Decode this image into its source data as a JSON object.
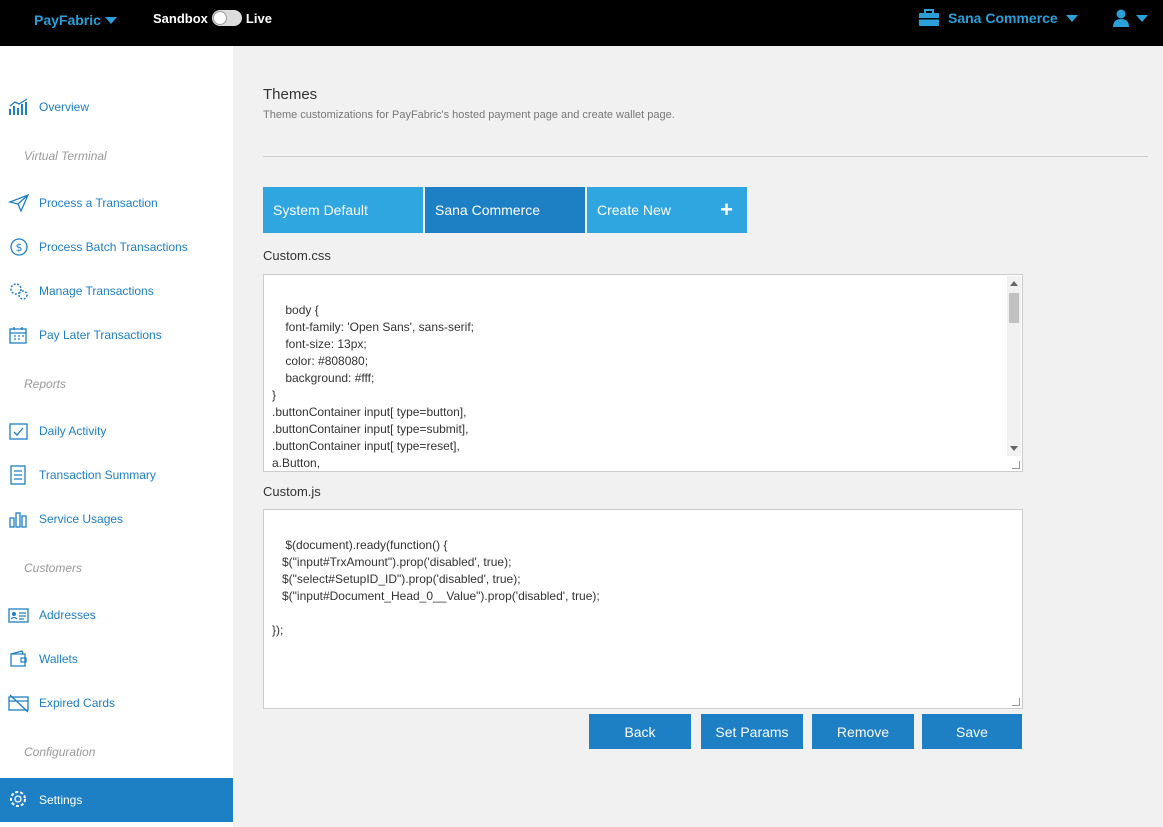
{
  "header": {
    "brand": "PayFabric",
    "env_left": "Sandbox",
    "env_right": "Live",
    "account": "Sana Commerce",
    "accent": "#2a9fd8"
  },
  "sidebar": {
    "items": [
      {
        "label": "Overview",
        "icon": "chart-icon"
      },
      {
        "label": "Process a Transaction",
        "icon": "send-icon"
      },
      {
        "label": "Process Batch Transactions",
        "icon": "dollar-cycle-icon"
      },
      {
        "label": "Manage Transactions",
        "icon": "gears-icon"
      },
      {
        "label": "Pay Later Transactions",
        "icon": "calendar-icon"
      },
      {
        "label": "Daily Activity",
        "icon": "calendar-check-icon"
      },
      {
        "label": "Transaction Summary",
        "icon": "list-icon"
      },
      {
        "label": "Service Usages",
        "icon": "bars-icon"
      },
      {
        "label": "Addresses",
        "icon": "address-card-icon"
      },
      {
        "label": "Wallets",
        "icon": "wallet-icon"
      },
      {
        "label": "Expired Cards",
        "icon": "card-off-icon"
      },
      {
        "label": "Settings",
        "icon": "gear-icon"
      }
    ],
    "sections": [
      "Virtual Terminal",
      "Reports",
      "Customers",
      "Configuration"
    ]
  },
  "main": {
    "title": "Themes",
    "subtitle": "Theme customizations for PayFabric's hosted payment page and create wallet page.",
    "tabs": [
      {
        "label": "System Default"
      },
      {
        "label": "Sana Commerce"
      },
      {
        "label": "Create New"
      }
    ],
    "css_label": "Custom.css",
    "css_value": "body {\n    font-family: 'Open Sans', sans-serif;\n    font-size: 13px;\n    color: #808080;\n    background: #fff;\n}\n.buttonContainer input[ type=button],\n.buttonContainer input[ type=submit],\n.buttonContainer input[ type=reset],\na.Button,\n.buttonContainer select {",
    "js_label": "Custom.js",
    "js_value": "$(document).ready(function() {\n   $(\"input#TrxAmount\").prop('disabled', true);\n   $(\"select#SetupID_ID\").prop('disabled', true);\n   $(\"input#Document_Head_0__Value\").prop('disabled', true);\n\n});",
    "buttons": {
      "back": "Back",
      "set_params": "Set Params",
      "remove": "Remove",
      "save": "Save"
    }
  }
}
